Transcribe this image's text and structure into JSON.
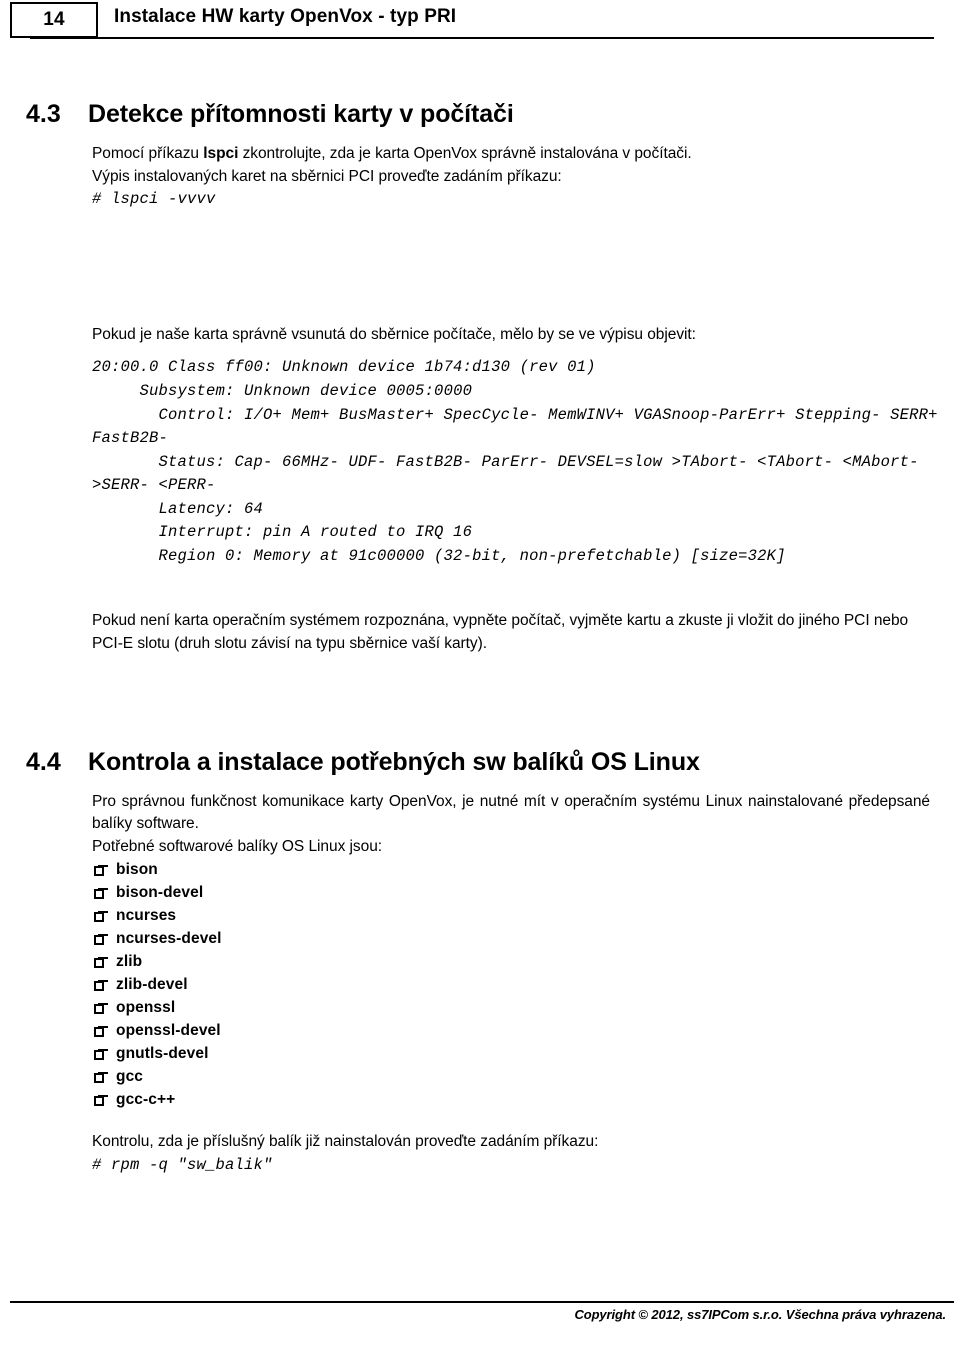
{
  "header": {
    "page_number": "14",
    "title": "Instalace HW karty OpenVox - typ PRI"
  },
  "sections": [
    {
      "number": "4.3",
      "title": "Detekce přítomnosti karty v počítači",
      "intro_before_bold": "Pomocí příkazu ",
      "intro_bold": "lspci",
      "intro_after_bold": " zkontrolujte, zda je karta OpenVox správně instalována v počítači.",
      "intro_line2": "Výpis instalovaných karet na sběrnici PCI proveďte zadáním příkazu:",
      "command": "# lspci -vvvv",
      "listing_intro": "Pokud je naše karta správně vsunutá do sběrnice počítače, mělo by se ve výpisu objevit:",
      "listing": "20:00.0 Class ff00: Unknown device 1b74:d130 (rev 01)\n     Subsystem: Unknown device 0005:0000\n       Control: I/O+ Mem+ BusMaster+ SpecCycle- MemWINV+ VGASnoop-ParErr+ Stepping- SERR+ FastB2B-\n       Status: Cap- 66MHz- UDF- FastB2B- ParErr- DEVSEL=slow >TAbort- <TAbort- <MAbort- >SERR- <PERR-\n       Latency: 64\n       Interrupt: pin A routed to IRQ 16\n       Region 0: Memory at 91c00000 (32-bit, non-prefetchable) [size=32K]",
      "outro": "Pokud není karta operačním systémem rozpoznána, vypněte počítač, vyjměte kartu a zkuste ji vložit do jiného PCI nebo PCI-E slotu (druh slotu závisí na typu sběrnice vaší karty)."
    },
    {
      "number": "4.4",
      "title": "Kontrola a instalace potřebných sw balíků OS Linux",
      "para1": "Pro správnou funkčnost komunikace karty OpenVox, je nutné mít v operačním systému Linux nainstalované předepsané balíky software.",
      "para2": "Potřebné softwarové balíky OS Linux jsou:",
      "packages": [
        "bison",
        "bison-devel",
        "ncurses",
        "ncurses-devel",
        "zlib",
        "zlib-devel",
        "openssl",
        "openssl-devel",
        "gnutls-devel",
        "gcc",
        "gcc-c++"
      ],
      "check_intro": "Kontrolu, zda je příslušný balík již nainstalován proveďte zadáním příkazu:",
      "check_command": "# rpm -q \"sw_balik\""
    }
  ],
  "footer": {
    "copyright": "Copyright © 2012, ss7IPCom s.r.o. Všechna práva vyhrazena."
  }
}
